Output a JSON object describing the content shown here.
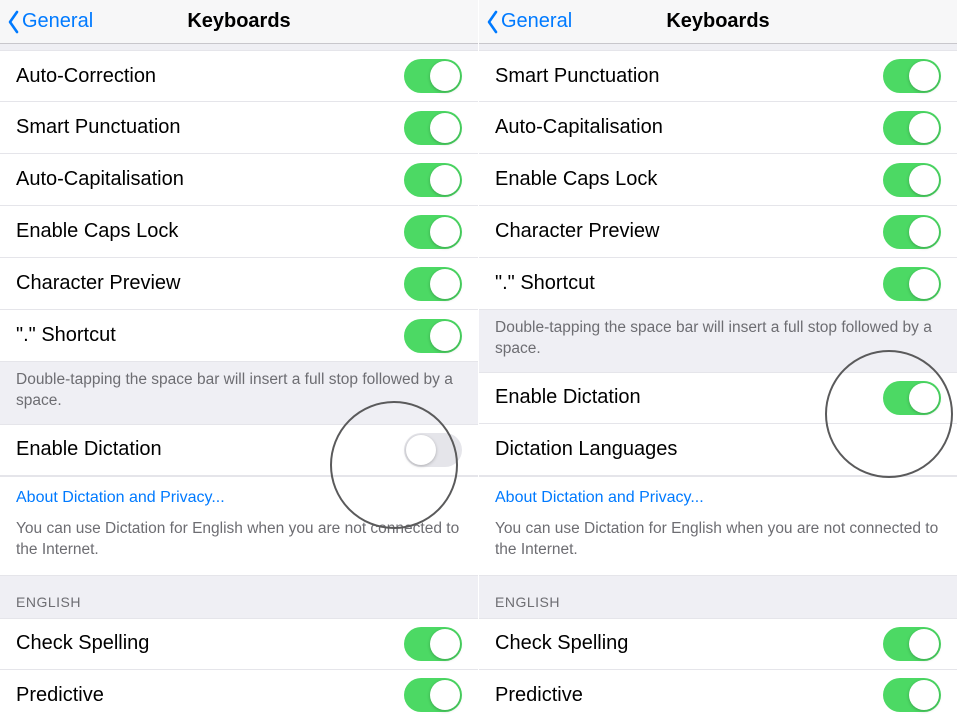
{
  "left": {
    "nav": {
      "back": "General",
      "title": "Keyboards"
    },
    "rows1": [
      {
        "label": "Auto-Correction",
        "on": true
      },
      {
        "label": "Smart Punctuation",
        "on": true
      },
      {
        "label": "Auto-Capitalisation",
        "on": true
      },
      {
        "label": "Enable Caps Lock",
        "on": true
      },
      {
        "label": "Character Preview",
        "on": true
      },
      {
        "label": "\".\" Shortcut",
        "on": true
      }
    ],
    "footer1": "Double-tapping the space bar will insert a full stop followed by a space.",
    "dictation_label": "Enable Dictation",
    "dictation_on": false,
    "about_link": "About Dictation and Privacy...",
    "dictation_info": "You can use Dictation for English when you are not connected to the Internet.",
    "english_header": "ENGLISH",
    "rows2": [
      {
        "label": "Check Spelling",
        "on": true
      },
      {
        "label": "Predictive",
        "on": true
      }
    ]
  },
  "right": {
    "nav": {
      "back": "General",
      "title": "Keyboards"
    },
    "rows1": [
      {
        "label": "Smart Punctuation",
        "on": true
      },
      {
        "label": "Auto-Capitalisation",
        "on": true
      },
      {
        "label": "Enable Caps Lock",
        "on": true
      },
      {
        "label": "Character Preview",
        "on": true
      },
      {
        "label": "\".\" Shortcut",
        "on": true
      }
    ],
    "footer1": "Double-tapping the space bar will insert a full stop followed by a space.",
    "dictation_label": "Enable Dictation",
    "dictation_on": true,
    "dictation_langs_label": "Dictation Languages",
    "about_link": "About Dictation and Privacy...",
    "dictation_info": "You can use Dictation for English when you are not connected to the Internet.",
    "english_header": "ENGLISH",
    "rows2": [
      {
        "label": "Check Spelling",
        "on": true
      },
      {
        "label": "Predictive",
        "on": true
      }
    ]
  }
}
